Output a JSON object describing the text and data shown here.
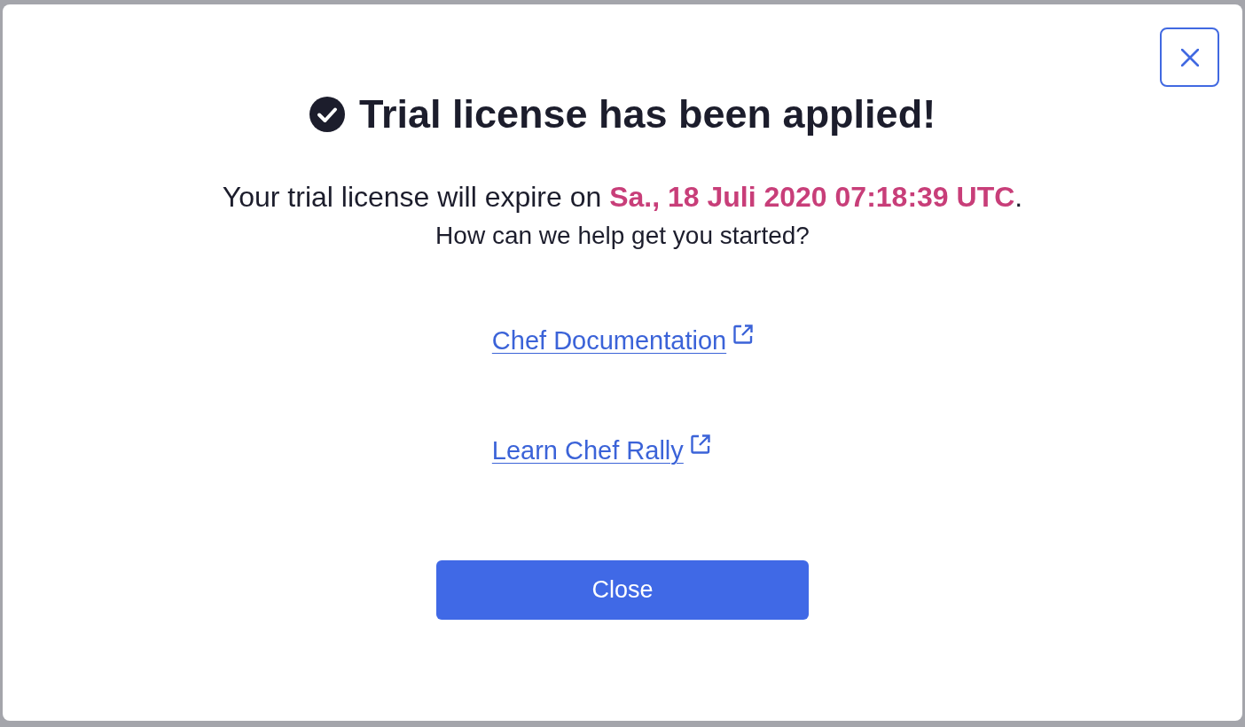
{
  "dialog": {
    "title": "Trial license has been applied!",
    "expiry_message": "Your trial license will expire on **Sa., 18 Juli 2020 07:18:39 UTC**.",
    "prompt": "How can we help get you started?",
    "links": [
      {
        "label": "Chef Documentation",
        "external": true
      },
      {
        "label": "Learn Chef Rally",
        "external": true
      }
    ],
    "primary_button": "Close"
  }
}
